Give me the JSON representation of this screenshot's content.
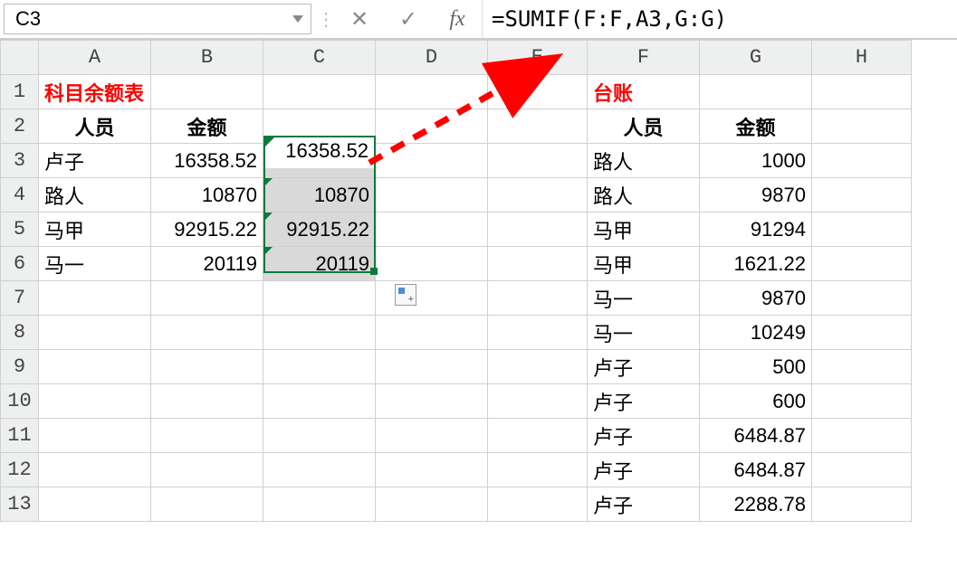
{
  "name_box": "C3",
  "formula": "=SUMIF(F:F,A3,G:G)",
  "fb_icons": {
    "divider": "⋮",
    "cancel": "✕",
    "accept": "✓",
    "fx": "fx"
  },
  "col_headers": [
    "A",
    "B",
    "C",
    "D",
    "E",
    "F",
    "G",
    "H"
  ],
  "row_headers": [
    "1",
    "2",
    "3",
    "4",
    "5",
    "6",
    "7",
    "8",
    "9",
    "10",
    "11",
    "12",
    "13"
  ],
  "titles": {
    "left": "科目余额表",
    "right": "台账"
  },
  "headers": {
    "person": "人员",
    "amount": "金额"
  },
  "left_table": [
    {
      "person": "卢子",
      "amount": "16358.52",
      "calc": "16358.52"
    },
    {
      "person": "路人",
      "amount": "10870",
      "calc": "10870"
    },
    {
      "person": "马甲",
      "amount": "92915.22",
      "calc": "92915.22"
    },
    {
      "person": "马一",
      "amount": "20119",
      "calc": "20119"
    }
  ],
  "right_table": [
    {
      "person": "路人",
      "amount": "1000"
    },
    {
      "person": "路人",
      "amount": "9870"
    },
    {
      "person": "马甲",
      "amount": "91294"
    },
    {
      "person": "马甲",
      "amount": "1621.22"
    },
    {
      "person": "马一",
      "amount": "9870"
    },
    {
      "person": "马一",
      "amount": "10249"
    },
    {
      "person": "卢子",
      "amount": "500"
    },
    {
      "person": "卢子",
      "amount": "600"
    },
    {
      "person": "卢子",
      "amount": "6484.87"
    },
    {
      "person": "卢子",
      "amount": "6484.87"
    },
    {
      "person": "卢子",
      "amount": "2288.78"
    }
  ],
  "selection": {
    "active_cell": "C3",
    "range": "C3:C6"
  }
}
